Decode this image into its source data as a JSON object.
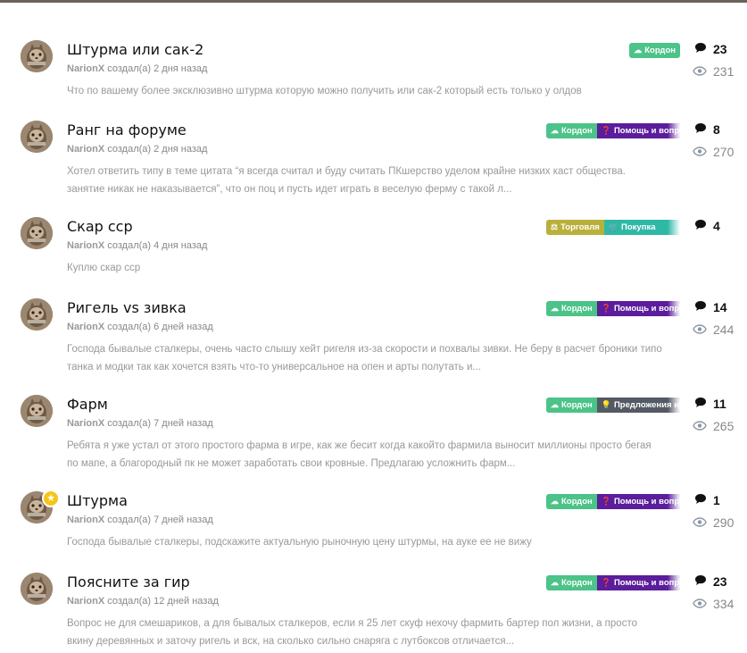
{
  "colors": {
    "kordon": "#4cc388",
    "help": "#5b1d9c",
    "proposals": "#545a63",
    "trade": "#b9b03c",
    "buy": "#2fb8a6"
  },
  "topics": [
    {
      "title": "Штурма или сак-2",
      "author": "NarionX",
      "created": "создал(а) 2 дня назад",
      "excerpt": "Что по вашему более эксклюзивно штурма которую можно получить или сак-2 который есть только у олдов",
      "tags": [
        {
          "label": "Кордон",
          "icon": "cloud-icon",
          "color": "#4cc388"
        }
      ],
      "replies": "23",
      "views": "231",
      "star": false
    },
    {
      "title": "Ранг на форуме",
      "author": "NarionX",
      "created": "создал(а) 2 дня назад",
      "excerpt": "Хотел ответить типу в теме цитата “я всегда считал и буду считать ПКшерство уделом крайне низких каст общества. занятие никак не наказывается”, что он поц и пусть идет играть в веселую ферму с такой л...",
      "tags": [
        {
          "label": "Кордон",
          "icon": "cloud-icon",
          "color": "#4cc388"
        },
        {
          "label": "Помощь и вопросы",
          "icon": "question-icon",
          "color": "#5b1d9c"
        }
      ],
      "replies": "8",
      "views": "270",
      "star": false
    },
    {
      "title": "Скар сср",
      "author": "NarionX",
      "created": "создал(а) 4 дня назад",
      "excerpt": "Куплю скар сср",
      "tags": [
        {
          "label": "Торговля",
          "icon": "scales-icon",
          "color": "#b9b03c"
        },
        {
          "label": "Покупка",
          "icon": "cart-icon",
          "color": "#2fb8a6"
        }
      ],
      "replies": "4",
      "views": "",
      "star": false
    },
    {
      "title": "Ригель vs зивка",
      "author": "NarionX",
      "created": "создал(а) 6 дней назад",
      "excerpt": "Господа бывалые сталкеры, очень часто слышу хейт ригеля из-за скорости и похвалы зивки. Не беру в расчет броники типо танка и модки так как хочется взять что-то универсальное на опен и арты полутать и...",
      "tags": [
        {
          "label": "Кордон",
          "icon": "cloud-icon",
          "color": "#4cc388"
        },
        {
          "label": "Помощь и вопросы",
          "icon": "question-icon",
          "color": "#5b1d9c"
        }
      ],
      "replies": "14",
      "views": "244",
      "star": false
    },
    {
      "title": "Фарм",
      "author": "NarionX",
      "created": "создал(а) 7 дней назад",
      "excerpt": "Ребята я уже устал от этого простого фарма в игре, как же бесит когда какойто фармила выносит миллионы просто бегая по мапе, а благородный пк не может заработать свои кровные. Предлагаю усложнить фарм...",
      "tags": [
        {
          "label": "Кордон",
          "icon": "cloud-icon",
          "color": "#4cc388"
        },
        {
          "label": "Предложения и идеи",
          "icon": "bulb-icon",
          "color": "#545a63"
        }
      ],
      "replies": "11",
      "views": "265",
      "star": false
    },
    {
      "title": "Штурма",
      "author": "NarionX",
      "created": "создал(а) 7 дней назад",
      "excerpt": "Господа бывалые сталкеры, подскажите актуальную рыночную цену штурмы, на ауке ее не вижу",
      "tags": [
        {
          "label": "Кордон",
          "icon": "cloud-icon",
          "color": "#4cc388"
        },
        {
          "label": "Помощь и вопросы",
          "icon": "question-icon",
          "color": "#5b1d9c"
        }
      ],
      "replies": "1",
      "views": "290",
      "star": true
    },
    {
      "title": "Поясните за гир",
      "author": "NarionX",
      "created": "создал(а) 12 дней назад",
      "excerpt": "Вопрос не для смешариков, а для бывалых сталкеров, если я 25 лет скуф нехочу фармить бартер пол жизни, а просто вкину деревянных и заточу ригель и вск, на сколько сильно снаряга с лутбоксов отличается...",
      "tags": [
        {
          "label": "Кордон",
          "icon": "cloud-icon",
          "color": "#4cc388"
        },
        {
          "label": "Помощь и вопросы",
          "icon": "question-icon",
          "color": "#5b1d9c"
        }
      ],
      "replies": "23",
      "views": "334",
      "star": false
    }
  ]
}
